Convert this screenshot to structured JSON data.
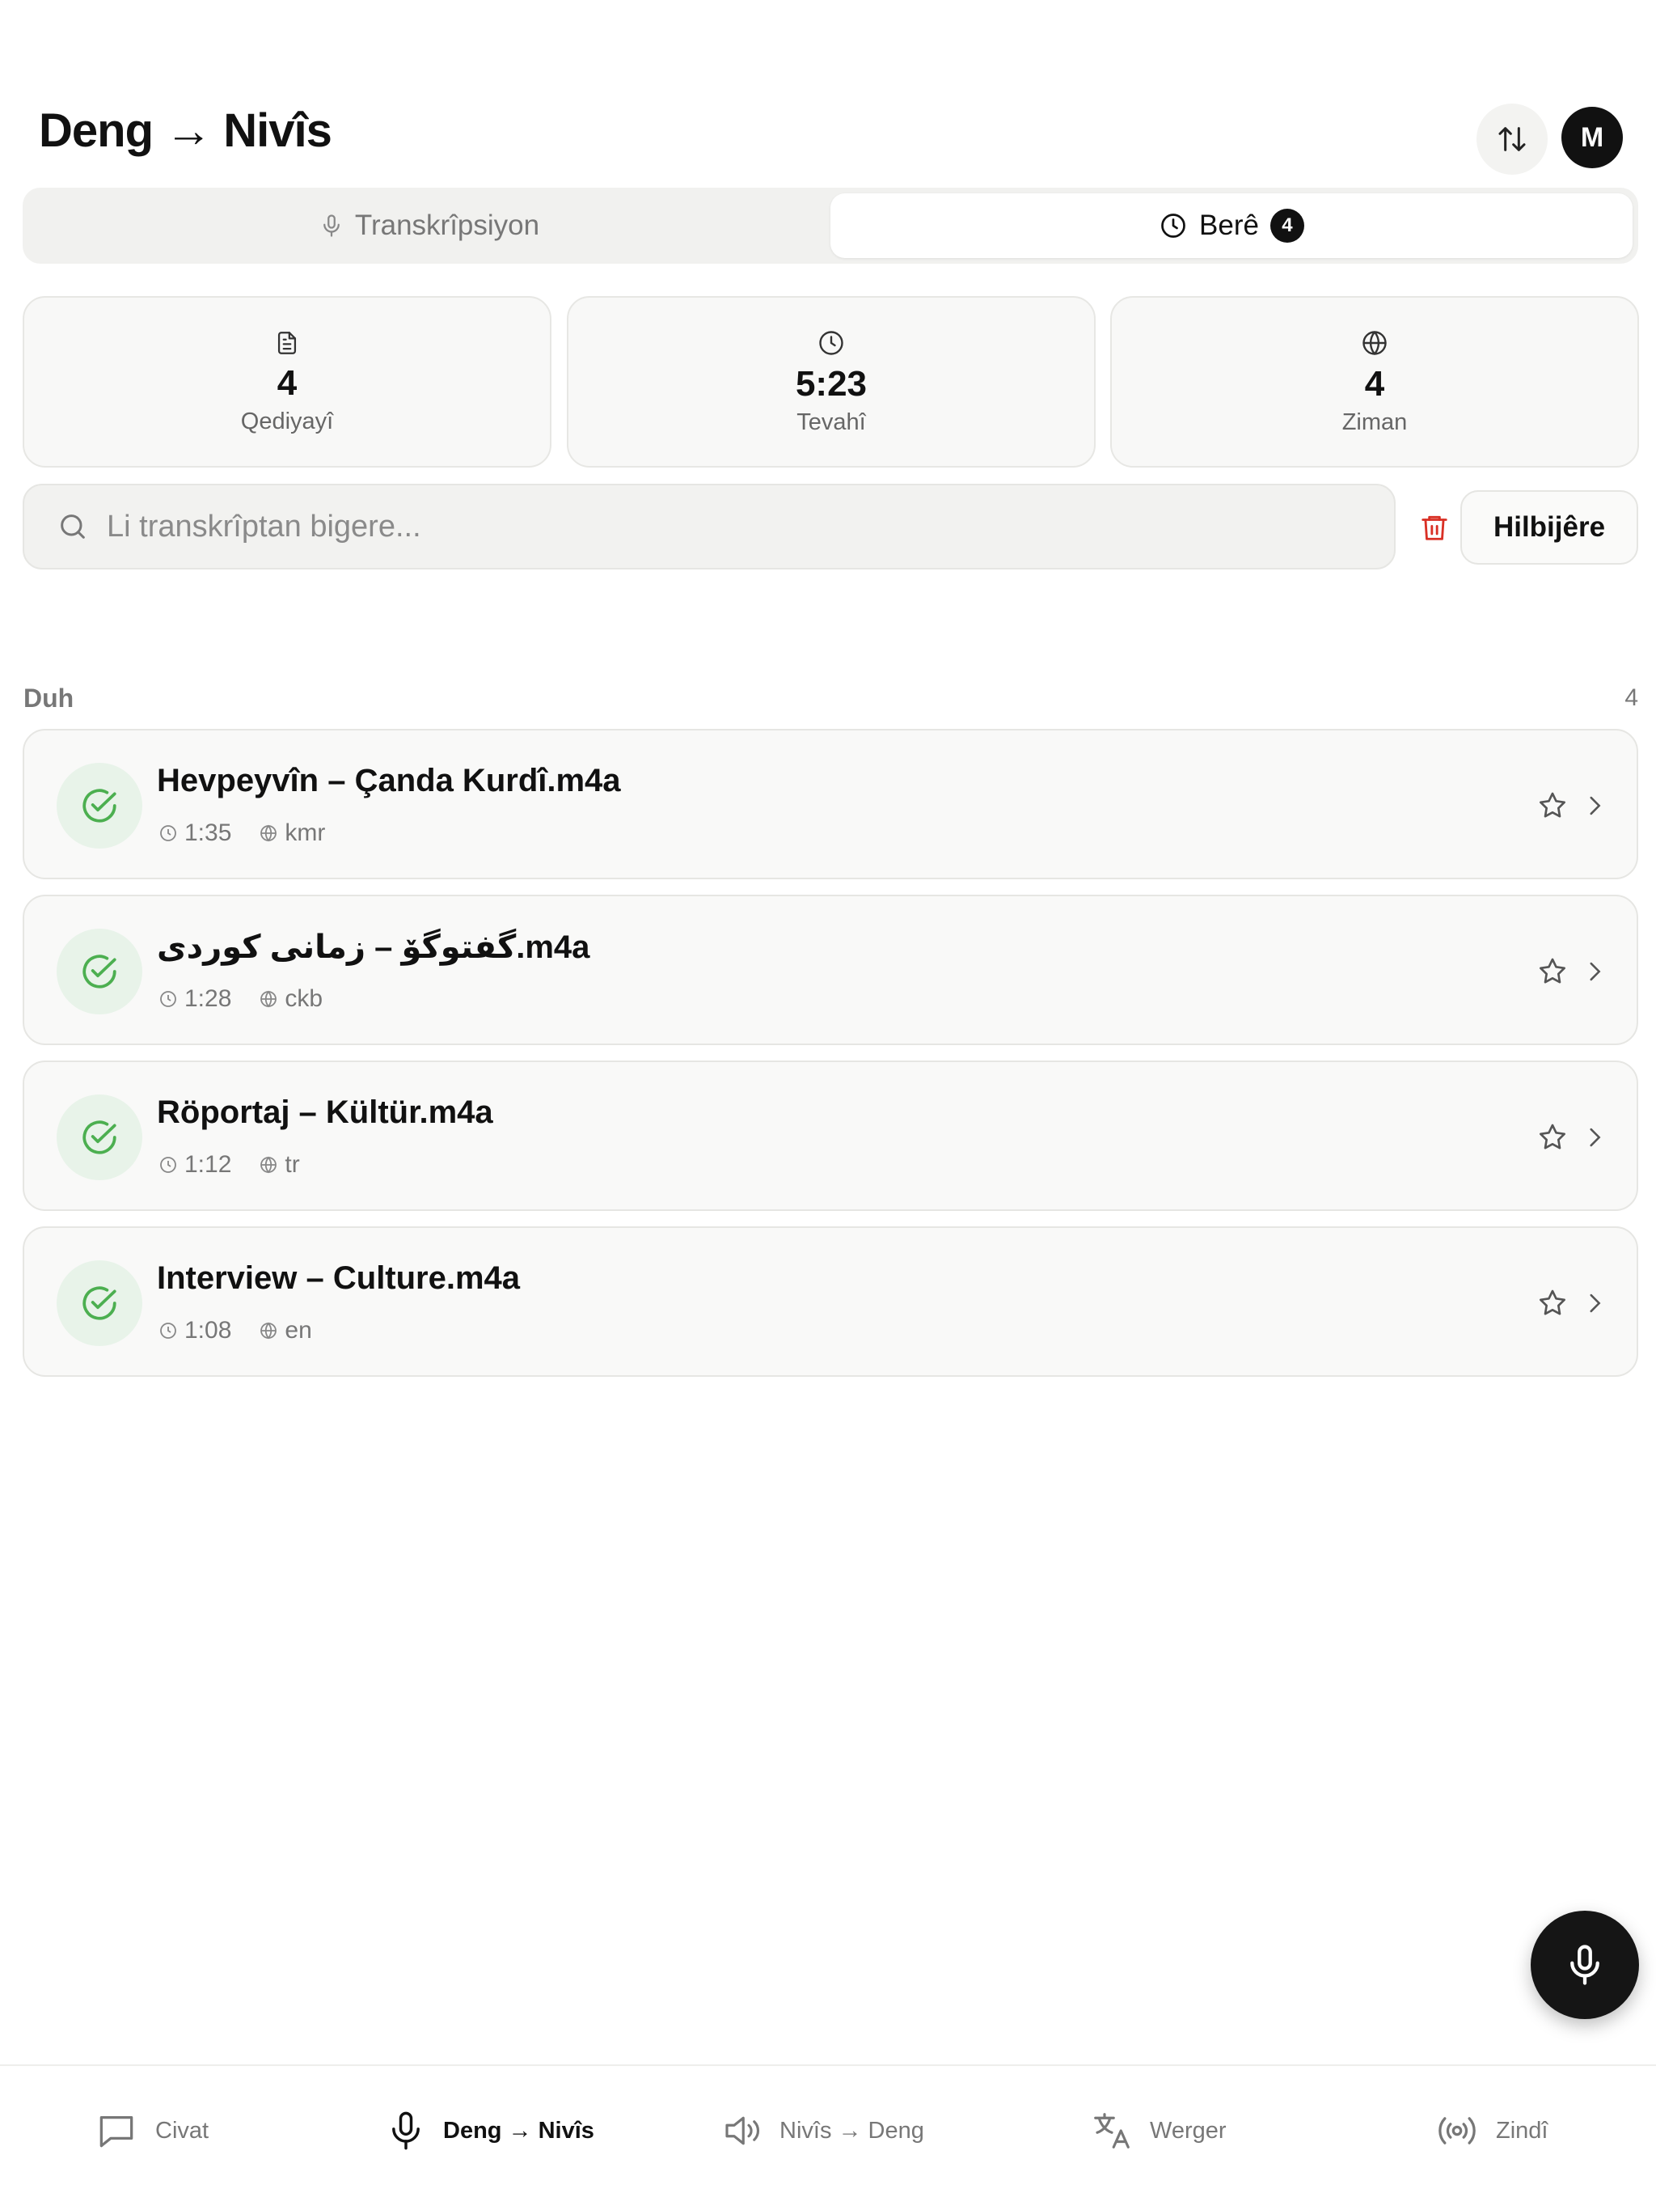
{
  "header": {
    "title": "Deng → Nivîs",
    "avatar_initial": "M"
  },
  "tabs": [
    {
      "label": "Transkrîpsiyon",
      "icon": "microphone-icon",
      "active": false
    },
    {
      "label": "Berê",
      "icon": "clock-icon",
      "active": true,
      "badge": "4"
    }
  ],
  "stats": [
    {
      "icon": "document-icon",
      "value": "4",
      "label": "Qediyayî"
    },
    {
      "icon": "clock-icon",
      "value": "5:23",
      "label": "Tevahî"
    },
    {
      "icon": "globe-icon",
      "value": "4",
      "label": "Ziman"
    }
  ],
  "search": {
    "placeholder": "Li transkrîptan bigere...",
    "value": ""
  },
  "toolbar": {
    "select_label": "Hilbijêre",
    "delete_icon": "trash-icon"
  },
  "section": {
    "title": "Duh",
    "count": "4"
  },
  "items": [
    {
      "name": "Hevpeyvîn – Çanda Kurdî.m4a",
      "duration": "1:35",
      "language": "kmr",
      "status": "completed"
    },
    {
      "name": "گفتوگۆ – زمانی کوردی.m4a",
      "duration": "1:28",
      "language": "ckb",
      "status": "completed"
    },
    {
      "name": "Röportaj – Kültür.m4a",
      "duration": "1:12",
      "language": "tr",
      "status": "completed"
    },
    {
      "name": "Interview – Culture.m4a",
      "duration": "1:08",
      "language": "en",
      "status": "completed"
    }
  ],
  "fab": {
    "icon": "microphone-icon"
  },
  "nav": [
    {
      "label": "Civat",
      "icon": "chat-bubble-icon",
      "active": false
    },
    {
      "label": "Deng → Nivîs",
      "icon": "microphone-icon",
      "active": true
    },
    {
      "label": "Nivîs → Deng",
      "icon": "speaker-icon",
      "active": false
    },
    {
      "label": "Werger",
      "icon": "translate-icon",
      "active": false
    },
    {
      "label": "Zindî",
      "icon": "broadcast-icon",
      "active": false
    }
  ],
  "colors": {
    "accent": "#111111",
    "success": "#4caf50",
    "success_bg": "#e8f3e9",
    "danger": "#d93025",
    "muted_text": "#777777",
    "surface": "#f8f8f7"
  }
}
